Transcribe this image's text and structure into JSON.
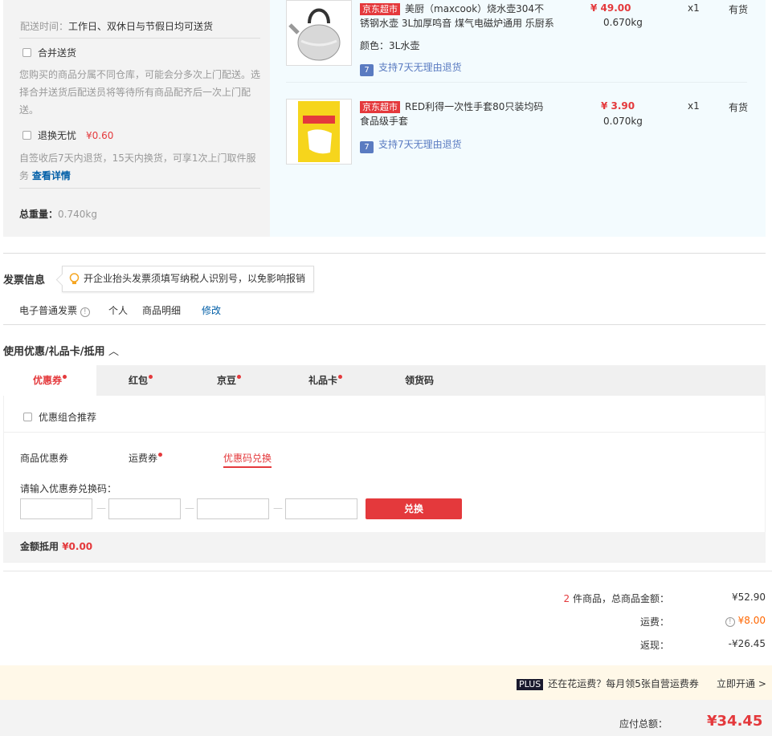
{
  "delivery": {
    "time_label": "配送时间：",
    "time_value": "工作日、双休日与节假日均可送货",
    "merge_label": "合并送货",
    "merge_desc_1": "您购买的商品分属不同仓库，可能会分多次上门配送。选",
    "merge_desc_2": "择合并送货后配送员将等待所有商品配齐后一次上门配",
    "merge_desc_3": "送。",
    "return_label": "退换无忧",
    "return_price": "¥0.60",
    "return_desc_1": "自签收后7天内退货，15天内换货，可享1次上门取件服",
    "return_desc_2": "务",
    "details_link": "查看详情",
    "weight_label": "总重量：",
    "weight_value": "0.740kg"
  },
  "products": [
    {
      "tag": "京东超市",
      "name_1": "美厨（maxcook）烧水壶304不",
      "name_2": "锈钢水壶 3L加厚鸣音 煤气电磁炉通用 乐厨系",
      "price": "¥ 49.00",
      "weight": "0.670kg",
      "qty": "x1",
      "stock": "有货",
      "spec": "颜色：3L水壶",
      "service": "支持7天无理由退货"
    },
    {
      "tag": "京东超市",
      "name_1": "RED利得一次性手套80只装均码",
      "name_2": "食品级手套",
      "price": "¥ 3.90",
      "weight": "0.070kg",
      "qty": "x1",
      "stock": "有货",
      "service": "支持7天无理由退货"
    }
  ],
  "invoice": {
    "title": "发票信息",
    "tip": "开企业抬头发票须填写纳税人识别号，以免影响报销",
    "type": "电子普通发票",
    "holder": "个人",
    "content": "商品明细",
    "edit": "修改"
  },
  "discount": {
    "title": "使用优惠/礼品卡/抵用",
    "tabs": [
      "优惠券",
      "红包",
      "京豆",
      "礼品卡",
      "领货码"
    ],
    "combo_label": "优惠组合推荐",
    "subtabs": [
      "商品优惠券",
      "运费券",
      "优惠码兑换"
    ],
    "code_label": "请输入优惠券兑换码：",
    "redeem_button": "兑换",
    "amount_label": "金额抵用",
    "amount_value": "¥0.00"
  },
  "summary": {
    "count": "2",
    "items_label": "件商品，总商品金额：",
    "items_total": "¥52.90",
    "shipping_label": "运费：",
    "shipping_value": "¥8.00",
    "cashback_label": "返现：",
    "cashback_value": "-¥26.45"
  },
  "plus": {
    "tag": "PLUS",
    "text": "还在花运费？每月领5张自营运费券",
    "link": "立即开通 >"
  },
  "total": {
    "label": "应付总额：",
    "value": "¥34.45"
  },
  "colors": {
    "accent": "#e4393c",
    "link": "#005ea7",
    "shipping": "#e4393c"
  }
}
